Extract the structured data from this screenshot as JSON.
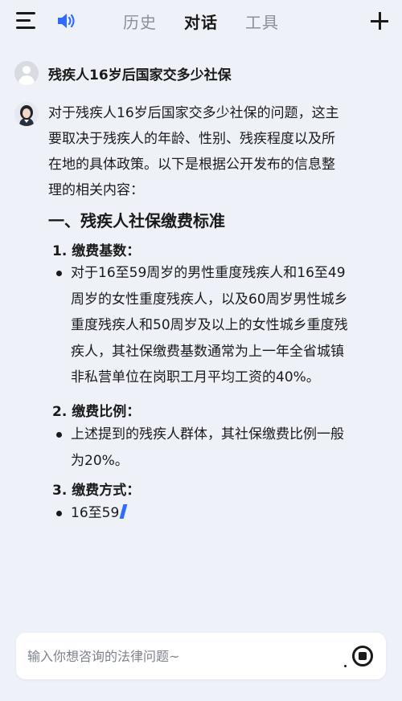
{
  "header": {
    "tabs": [
      {
        "label": "历史",
        "active": false
      },
      {
        "label": "对话",
        "active": true
      },
      {
        "label": "工具",
        "active": false
      }
    ],
    "icons": [
      "menu-icon",
      "speaker-icon",
      "plus-icon"
    ]
  },
  "chat": {
    "user_question": "残疾人16岁后国家交多少社保",
    "answer_intro_lines": [
      "对于残疾人16岁后国家交多少社保的问题，这主",
      "要取决于残疾人的年龄、性别、残疾程度以及所",
      "在地的具体政策。以下是根据公开发布的信息整",
      "理的相关内容："
    ],
    "section_title": "一、残疾人社保缴费标准",
    "items": [
      {
        "label": "1. 缴费基数：",
        "bullet_lines": [
          "对于16至59周岁的男性重度残疾人和16至49",
          "周岁的女性重度残疾人，以及60周岁男性城乡",
          "重度残疾人和50周岁及以上的女性城乡重度残",
          "疾人，其社保缴费基数通常为上一年全省城镇",
          "非私营单位在岗职工月平均工资的40%。"
        ]
      },
      {
        "label": "2. 缴费比例：",
        "bullet_lines": [
          "上述提到的残疾人群体，其社保缴费比例一般",
          "为20%。"
        ]
      },
      {
        "label": "3. 缴费方式：",
        "bullet_lines": [
          "16至59"
        ]
      }
    ]
  },
  "input": {
    "placeholder": "输入你想咨询的法律问题~",
    "value": ""
  },
  "colors": {
    "background": "#eef1f8",
    "accent": "#2f6bff",
    "text": "#1a1a1a",
    "muted": "#8a8f99"
  }
}
